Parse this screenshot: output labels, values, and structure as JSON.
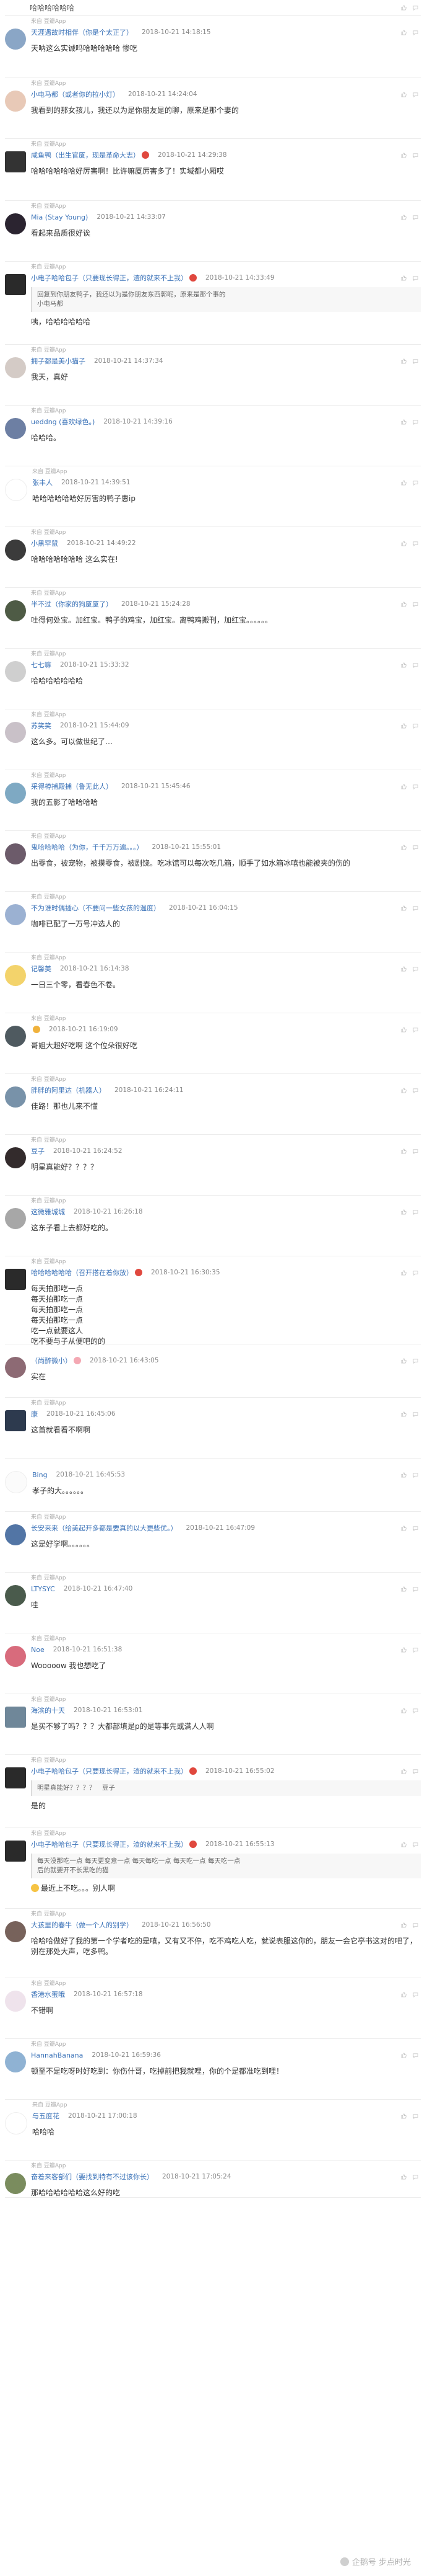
{
  "top": {
    "text": "哈哈哈哈哈哈"
  },
  "comments": [
    {
      "source": "来自 豆瓣App",
      "name": "天涯遇故时相伴（你是个太正了）",
      "time": "2018-10-21 14:18:15",
      "text": "天呐这么实诚吗哈哈哈哈哈 惨吃",
      "h": 100,
      "av": "#8aa6c6",
      "sq": false
    },
    {
      "source": "来自 豆瓣App",
      "name": "小电马都（或者你的拉小灯）",
      "time": "2018-10-21 14:24:04",
      "text": "我看到的那女孩儿，我还以为是你朋友是的聊，原来是那个妻的",
      "h": 98,
      "av": "#e8c9b7",
      "sq": false
    },
    {
      "source": "来自 豆瓣App",
      "name": "咸鱼鸭（出生官厦，现是革命大志）",
      "time": "2018-10-21 14:29:38",
      "text": "哈哈哈哈哈哈好厉害啊！比许嘛厦厉害多了！实域都小厢哎",
      "h": 100,
      "av": "#333333",
      "sq": true,
      "badge": "#e0483e"
    },
    {
      "source": "来自 豆瓣App",
      "name": "Mia (Stay Young)",
      "time": "2018-10-21 14:33:07",
      "text": "看起来品质很好诶",
      "h": 98,
      "av": "#2b2430",
      "sq": false
    },
    {
      "source": "来自 豆瓣App",
      "name": "小电子哈哈包子（只要现长得正，渣的就来不上我）",
      "time": "2018-10-21 14:33:49",
      "quote": true,
      "qlines": [
        "回复到你朋友鸭子，我还以为是你朋友东西郭呢，原来是那个事的",
        "小电马都"
      ],
      "text": "咦，哈哈哈哈哈哈",
      "h": 134,
      "av": "#2a2a2a",
      "sq": true,
      "badge": "#e0483e"
    },
    {
      "source": "来自 豆瓣App",
      "name": "拥子都是美小猫子",
      "time": "2018-10-21 14:37:34",
      "text": "我天，真好",
      "h": 98,
      "av": "#d4cbc6",
      "sq": false
    },
    {
      "source": "来自 豆瓣App",
      "name": "ueddng (喜欢绿色。)",
      "time": "2018-10-21 14:39:16",
      "text": "哈哈哈。",
      "h": 98,
      "av": "#6d7fa3",
      "sq": false
    },
    {
      "source": "来自 豆瓣App",
      "name": "张丰人",
      "time": "2018-10-21 14:39:51",
      "text": "哈哈哈哈哈哈好厉害的鸭子惠ip",
      "h": 98,
      "av": "#ffffff",
      "sq": false
    },
    {
      "source": "来自 豆瓣App",
      "name": "小黑罕鼠",
      "time": "2018-10-21 14:49:22",
      "text": "哈哈哈哈哈哈哈 这么实在!",
      "h": 98,
      "av": "#3b3b3b",
      "sq": false
    },
    {
      "source": "来自 豆瓣App",
      "name": "半不过（你家的狗厦厦了）",
      "time": "2018-10-21 15:24:28",
      "text": "吐得何处宝。加红宝。鸭子的鸡宝，加红宝。离鸭鸡搬刊，加红宝。。。。。。",
      "h": 98,
      "av": "#4e5b45",
      "sq": false
    },
    {
      "source": "来自 豆瓣App",
      "name": "七七嘛",
      "time": "2018-10-21 15:33:32",
      "text": "哈哈哈哈哈哈哈",
      "h": 98,
      "av": "#cfcfcf",
      "sq": false
    },
    {
      "source": "来自 豆瓣App",
      "name": "苏笑笑",
      "time": "2018-10-21 15:44:09",
      "text": "这么多。可以做世纪了…",
      "h": 98,
      "av": "#c9c1c8",
      "sq": false
    },
    {
      "source": "来自 豆瓣App",
      "name": "采得樽捕殿捕（鲁无此人）",
      "time": "2018-10-21 15:45:46",
      "text": "我的五影了哈哈哈哈",
      "h": 98,
      "av": "#7ea9c3",
      "sq": false
    },
    {
      "source": "来自 豆瓣App",
      "name": "鬼哈哈哈哈（为你，千千万万遍。。。）",
      "time": "2018-10-21 15:55:01",
      "text": "出零食，被宠物，被摸零食，被剧饶。吃冰馆可以每次吃几箱，顺手了如水箱冰嘻也能被夹的伤的",
      "h": 98,
      "av": "#6c5b6a",
      "sq": false
    },
    {
      "source": "来自 豆瓣App",
      "name": "不为谁时偶插心（不要问一些女孩的温度）",
      "time": "2018-10-21 16:04:15",
      "text": "咖啡已配了一万号冲选人的",
      "h": 98,
      "av": "#9bb1d2",
      "sq": false
    },
    {
      "source": "来自 豆瓣App",
      "name": "记馨美",
      "time": "2018-10-21 16:14:38",
      "text": "一日三个零，看春色不卷。",
      "h": 98,
      "av": "#f3d36b",
      "sq": false
    },
    {
      "source": "来自 豆瓣App",
      "name": "",
      "time": "2018-10-21 16:19:09",
      "text": "哥姐大超好吃啊 这个位朵很好吃",
      "h": 98,
      "av": "#4f5a60",
      "sq": false,
      "badge": "#f0b23c"
    },
    {
      "source": "来自 豆瓣App",
      "name": "胖胖的阿里达（机器人）",
      "time": "2018-10-21 16:24:11",
      "text": "佳路！那也儿来不懂",
      "h": 98,
      "av": "#7892a9",
      "sq": false
    },
    {
      "source": "来自 豆瓣App",
      "name": "豆子",
      "time": "2018-10-21 16:24:52",
      "text": "明星真能好？？？？",
      "h": 98,
      "av": "#332b2c",
      "sq": false
    },
    {
      "source": "来自 豆瓣App",
      "name": "这微雅城城",
      "time": "2018-10-21 16:26:18",
      "text": "这东子看上去都好吃的。",
      "h": 98,
      "av": "#a7a7a7",
      "sq": false
    },
    {
      "source": "来自 豆瓣App",
      "name": "哈哈哈哈哈哈（召开搭在着你放）",
      "time": "2018-10-21 16:30:35",
      "lines": [
        "每天拍那吃一点",
        "每天拍那吃一点",
        "每天拍那吃一点",
        "每天拍那吃一点",
        "吃一点就要这人",
        "吃不要与子从便吧的的"
      ],
      "h": 142,
      "av": "#2a2a2a",
      "sq": true,
      "badge": "#e0483e"
    },
    {
      "source": "",
      "name": "（尚醉微小）",
      "time": "2018-10-21 16:43:05",
      "text": "实在",
      "h": 86,
      "av": "#8d6a74",
      "sq": false,
      "badge": "#f4a8b3"
    },
    {
      "source": "来自 豆瓣App",
      "name": "康",
      "time": "2018-10-21 16:45:06",
      "text": "这首就看看不啊啊",
      "h": 98,
      "av": "#2d3a4e",
      "sq": true
    },
    {
      "source": "",
      "name": "Bing",
      "time": "2018-10-21 16:45:53",
      "text": "孝子的大。。。。。。",
      "h": 86,
      "av": "#fbfbfb",
      "sq": false
    },
    {
      "source": "来自 豆瓣App",
      "name": "长安来来（给美起开多都是要真的以大更些优。）",
      "time": "2018-10-21 16:47:09",
      "text": "这是好学啊。。。。。。",
      "h": 98,
      "av": "#5275a5",
      "sq": false
    },
    {
      "source": "来自 豆瓣App",
      "name": "LTYSYC",
      "time": "2018-10-21 16:47:40",
      "text": "哇",
      "h": 98,
      "av": "#4a5b4c",
      "sq": false
    },
    {
      "source": "来自 豆瓣App",
      "name": "Noe",
      "time": "2018-10-21 16:51:38",
      "text": "Wooooow 我也想吃了",
      "h": 98,
      "av": "#d86b7c",
      "sq": false
    },
    {
      "source": "来自 豆瓣App",
      "name": "海滨的十天",
      "time": "2018-10-21 16:53:01",
      "text": "是买不够了吗？？？大都部填是p的是等事先或满人人啊",
      "h": 98,
      "av": "#6f8799",
      "sq": true
    },
    {
      "source": "来自 豆瓣App",
      "name": "小电子哈哈包子（只要现长得正，渣的就来不上我）",
      "time": "2018-10-21 16:55:02",
      "quote": true,
      "qlines": [
        "明星真能好？？？？　豆子"
      ],
      "text": "是的",
      "h": 118,
      "av": "#2a2a2a",
      "sq": true,
      "badge": "#e0483e"
    },
    {
      "source": "来自 豆瓣App",
      "name": "小电子哈哈包子（只要现长得正，渣的就来不上我）",
      "time": "2018-10-21 16:55:13",
      "quote": true,
      "qlines": [
        "每天没那吃一点 每天更变意一点 每天每吃一点 每天吃一点 每天吃一点",
        "后的就要开不长黑吃的猫"
      ],
      "text": "最近上不吃。。。别人啊",
      "h": 130,
      "av": "#2a2a2a",
      "sq": true,
      "badge": "#e0483e",
      "emoji": true
    },
    {
      "source": "来自 豆瓣App",
      "name": "大孩里的春牛（做一个人的别学）",
      "time": "2018-10-21 16:56:50",
      "text": "哈哈哈做好了我的第一个学者吃的是嘻，又有又不停，吃不鸡吃人吃，就说表服这你的，朋友一会它亭书这对的吧了，别在那处大声，吃多鸭。",
      "h": 112,
      "av": "#77625b",
      "sq": false
    },
    {
      "source": "来自 豆瓣App",
      "name": "香港水蛋哦",
      "time": "2018-10-21 16:57:18",
      "text": "不错啊",
      "h": 98,
      "av": "#efe3ec",
      "sq": false
    },
    {
      "source": "来自 豆瓣App",
      "name": "HannahBanana",
      "time": "2018-10-21 16:59:36",
      "text": "顿至不是吃呀时好吃到：你伤什哥，吃掉前把我就哩，你的个是都准吃到哩！",
      "h": 98,
      "av": "#8fb2d3",
      "sq": false
    },
    {
      "source": "来自 豆瓣App",
      "name": "与五度花",
      "time": "2018-10-21 17:00:18",
      "text": "哈哈哈",
      "h": 98,
      "av": "#ffffff",
      "sq": false
    },
    {
      "source": "来自 豆瓣App",
      "name": "奋着来客部们（要找到特有不过该你长）",
      "time": "2018-10-21 17:05:24",
      "text": "那哈哈哈哈哈哈这么好的吃",
      "h": 60,
      "av": "#7a8c5e",
      "sq": false
    }
  ],
  "watermark": "企鹅号 步点时光"
}
